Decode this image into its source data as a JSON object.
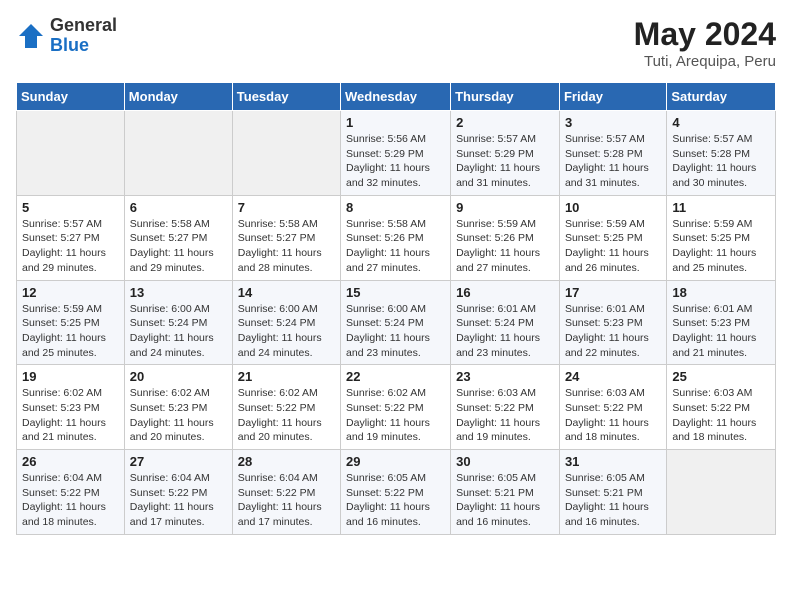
{
  "logo": {
    "general": "General",
    "blue": "Blue"
  },
  "title": {
    "month_year": "May 2024",
    "location": "Tuti, Arequipa, Peru"
  },
  "weekdays": [
    "Sunday",
    "Monday",
    "Tuesday",
    "Wednesday",
    "Thursday",
    "Friday",
    "Saturday"
  ],
  "weeks": [
    [
      {
        "day": "",
        "info": ""
      },
      {
        "day": "",
        "info": ""
      },
      {
        "day": "",
        "info": ""
      },
      {
        "day": "1",
        "info": "Sunrise: 5:56 AM\nSunset: 5:29 PM\nDaylight: 11 hours and 32 minutes."
      },
      {
        "day": "2",
        "info": "Sunrise: 5:57 AM\nSunset: 5:29 PM\nDaylight: 11 hours and 31 minutes."
      },
      {
        "day": "3",
        "info": "Sunrise: 5:57 AM\nSunset: 5:28 PM\nDaylight: 11 hours and 31 minutes."
      },
      {
        "day": "4",
        "info": "Sunrise: 5:57 AM\nSunset: 5:28 PM\nDaylight: 11 hours and 30 minutes."
      }
    ],
    [
      {
        "day": "5",
        "info": "Sunrise: 5:57 AM\nSunset: 5:27 PM\nDaylight: 11 hours and 29 minutes."
      },
      {
        "day": "6",
        "info": "Sunrise: 5:58 AM\nSunset: 5:27 PM\nDaylight: 11 hours and 29 minutes."
      },
      {
        "day": "7",
        "info": "Sunrise: 5:58 AM\nSunset: 5:27 PM\nDaylight: 11 hours and 28 minutes."
      },
      {
        "day": "8",
        "info": "Sunrise: 5:58 AM\nSunset: 5:26 PM\nDaylight: 11 hours and 27 minutes."
      },
      {
        "day": "9",
        "info": "Sunrise: 5:59 AM\nSunset: 5:26 PM\nDaylight: 11 hours and 27 minutes."
      },
      {
        "day": "10",
        "info": "Sunrise: 5:59 AM\nSunset: 5:25 PM\nDaylight: 11 hours and 26 minutes."
      },
      {
        "day": "11",
        "info": "Sunrise: 5:59 AM\nSunset: 5:25 PM\nDaylight: 11 hours and 25 minutes."
      }
    ],
    [
      {
        "day": "12",
        "info": "Sunrise: 5:59 AM\nSunset: 5:25 PM\nDaylight: 11 hours and 25 minutes."
      },
      {
        "day": "13",
        "info": "Sunrise: 6:00 AM\nSunset: 5:24 PM\nDaylight: 11 hours and 24 minutes."
      },
      {
        "day": "14",
        "info": "Sunrise: 6:00 AM\nSunset: 5:24 PM\nDaylight: 11 hours and 24 minutes."
      },
      {
        "day": "15",
        "info": "Sunrise: 6:00 AM\nSunset: 5:24 PM\nDaylight: 11 hours and 23 minutes."
      },
      {
        "day": "16",
        "info": "Sunrise: 6:01 AM\nSunset: 5:24 PM\nDaylight: 11 hours and 23 minutes."
      },
      {
        "day": "17",
        "info": "Sunrise: 6:01 AM\nSunset: 5:23 PM\nDaylight: 11 hours and 22 minutes."
      },
      {
        "day": "18",
        "info": "Sunrise: 6:01 AM\nSunset: 5:23 PM\nDaylight: 11 hours and 21 minutes."
      }
    ],
    [
      {
        "day": "19",
        "info": "Sunrise: 6:02 AM\nSunset: 5:23 PM\nDaylight: 11 hours and 21 minutes."
      },
      {
        "day": "20",
        "info": "Sunrise: 6:02 AM\nSunset: 5:23 PM\nDaylight: 11 hours and 20 minutes."
      },
      {
        "day": "21",
        "info": "Sunrise: 6:02 AM\nSunset: 5:22 PM\nDaylight: 11 hours and 20 minutes."
      },
      {
        "day": "22",
        "info": "Sunrise: 6:02 AM\nSunset: 5:22 PM\nDaylight: 11 hours and 19 minutes."
      },
      {
        "day": "23",
        "info": "Sunrise: 6:03 AM\nSunset: 5:22 PM\nDaylight: 11 hours and 19 minutes."
      },
      {
        "day": "24",
        "info": "Sunrise: 6:03 AM\nSunset: 5:22 PM\nDaylight: 11 hours and 18 minutes."
      },
      {
        "day": "25",
        "info": "Sunrise: 6:03 AM\nSunset: 5:22 PM\nDaylight: 11 hours and 18 minutes."
      }
    ],
    [
      {
        "day": "26",
        "info": "Sunrise: 6:04 AM\nSunset: 5:22 PM\nDaylight: 11 hours and 18 minutes."
      },
      {
        "day": "27",
        "info": "Sunrise: 6:04 AM\nSunset: 5:22 PM\nDaylight: 11 hours and 17 minutes."
      },
      {
        "day": "28",
        "info": "Sunrise: 6:04 AM\nSunset: 5:22 PM\nDaylight: 11 hours and 17 minutes."
      },
      {
        "day": "29",
        "info": "Sunrise: 6:05 AM\nSunset: 5:22 PM\nDaylight: 11 hours and 16 minutes."
      },
      {
        "day": "30",
        "info": "Sunrise: 6:05 AM\nSunset: 5:21 PM\nDaylight: 11 hours and 16 minutes."
      },
      {
        "day": "31",
        "info": "Sunrise: 6:05 AM\nSunset: 5:21 PM\nDaylight: 11 hours and 16 minutes."
      },
      {
        "day": "",
        "info": ""
      }
    ]
  ]
}
